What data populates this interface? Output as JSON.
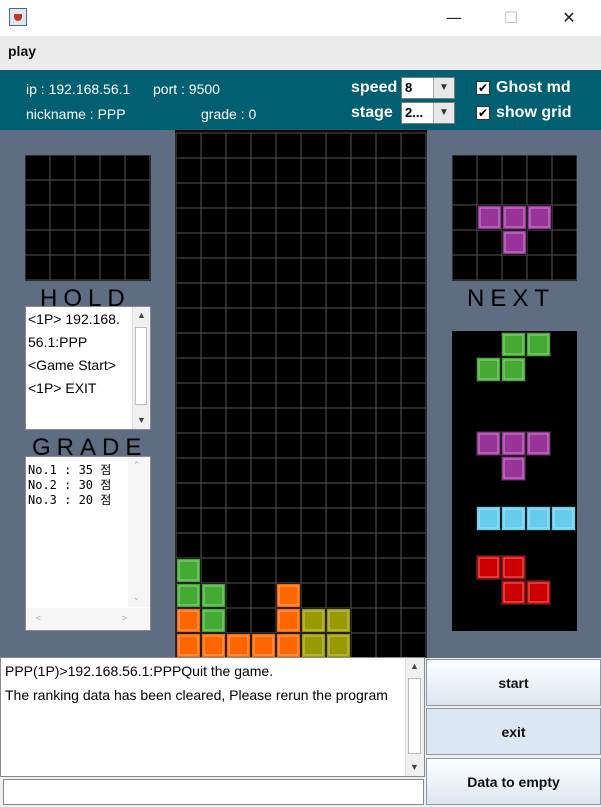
{
  "window": {
    "minimize_icon": "minimize-icon",
    "maximize_icon": "maximize-icon",
    "close_icon": "close-icon"
  },
  "menu": {
    "play": "play"
  },
  "info": {
    "ip_label": "ip : 192.168.56.1",
    "port_label": "port : 9500",
    "nickname_label": "nickname : PPP",
    "grade_label": "grade : 0"
  },
  "settings": {
    "speed_label": "speed",
    "speed_value": "8",
    "stage_label": "stage",
    "stage_value": "2...",
    "ghost_label": "Ghost md",
    "ghost_checked": true,
    "grid_label": "show grid",
    "grid_checked": true
  },
  "hold": {
    "caption": "HOLD"
  },
  "next": {
    "caption": "NEXT"
  },
  "log": {
    "lines": [
      "<1P> 192.168.",
      "56.1:PPP",
      "<Game Start>",
      "<1P> EXIT"
    ]
  },
  "grade": {
    "caption": "GRADE",
    "entries": [
      "No.1 : 35 점",
      "No.2 : 30 점",
      "No.3 : 20 점"
    ]
  },
  "chat": {
    "lines": [
      "PPP(1P)>192.168.56.1:PPPQuit the game.",
      "The ranking data has been cleared, Please rerun the program"
    ],
    "input_value": ""
  },
  "buttons": {
    "start": "start",
    "exit": "exit",
    "empty": "Data to empty"
  },
  "colors": {
    "panel_bg": "#5e6d82",
    "topbar_bg": "#015f72",
    "green": "#44aa33",
    "orange": "#ff6600",
    "olive": "#999900",
    "purple": "#993399",
    "cyan": "#66ccee",
    "red": "#cc0000"
  },
  "board": {
    "cols": 10,
    "rows": 21,
    "cells": [
      {
        "row": 17,
        "col": 0,
        "color": "green"
      },
      {
        "row": 18,
        "col": 0,
        "color": "green"
      },
      {
        "row": 18,
        "col": 1,
        "color": "green"
      },
      {
        "row": 18,
        "col": 4,
        "color": "orange"
      },
      {
        "row": 19,
        "col": 0,
        "color": "orange"
      },
      {
        "row": 19,
        "col": 1,
        "color": "green"
      },
      {
        "row": 19,
        "col": 4,
        "color": "orange"
      },
      {
        "row": 19,
        "col": 5,
        "color": "olive"
      },
      {
        "row": 19,
        "col": 6,
        "color": "olive"
      },
      {
        "row": 20,
        "col": 0,
        "color": "orange"
      },
      {
        "row": 20,
        "col": 1,
        "color": "orange"
      },
      {
        "row": 20,
        "col": 2,
        "color": "orange"
      },
      {
        "row": 20,
        "col": 3,
        "color": "orange"
      },
      {
        "row": 20,
        "col": 4,
        "color": "orange"
      },
      {
        "row": 20,
        "col": 5,
        "color": "olive"
      },
      {
        "row": 20,
        "col": 6,
        "color": "olive"
      }
    ]
  },
  "next_piece": {
    "cols": 5,
    "rows": 5,
    "cells": [
      {
        "row": 2,
        "col": 1,
        "color": "purple"
      },
      {
        "row": 2,
        "col": 2,
        "color": "purple"
      },
      {
        "row": 2,
        "col": 3,
        "color": "purple"
      },
      {
        "row": 3,
        "col": 2,
        "color": "purple"
      }
    ]
  },
  "queue": [
    {
      "color": "green",
      "cells": [
        [
          0,
          1
        ],
        [
          0,
          2
        ],
        [
          1,
          0
        ],
        [
          1,
          1
        ]
      ]
    },
    {
      "color": "purple",
      "cells": [
        [
          0,
          0
        ],
        [
          0,
          1
        ],
        [
          0,
          2
        ],
        [
          1,
          1
        ]
      ]
    },
    {
      "color": "cyan",
      "cells": [
        [
          0,
          0
        ],
        [
          0,
          1
        ],
        [
          0,
          2
        ],
        [
          0,
          3
        ]
      ]
    },
    {
      "color": "red",
      "cells": [
        [
          0,
          0
        ],
        [
          0,
          1
        ],
        [
          1,
          1
        ],
        [
          1,
          2
        ]
      ]
    }
  ]
}
